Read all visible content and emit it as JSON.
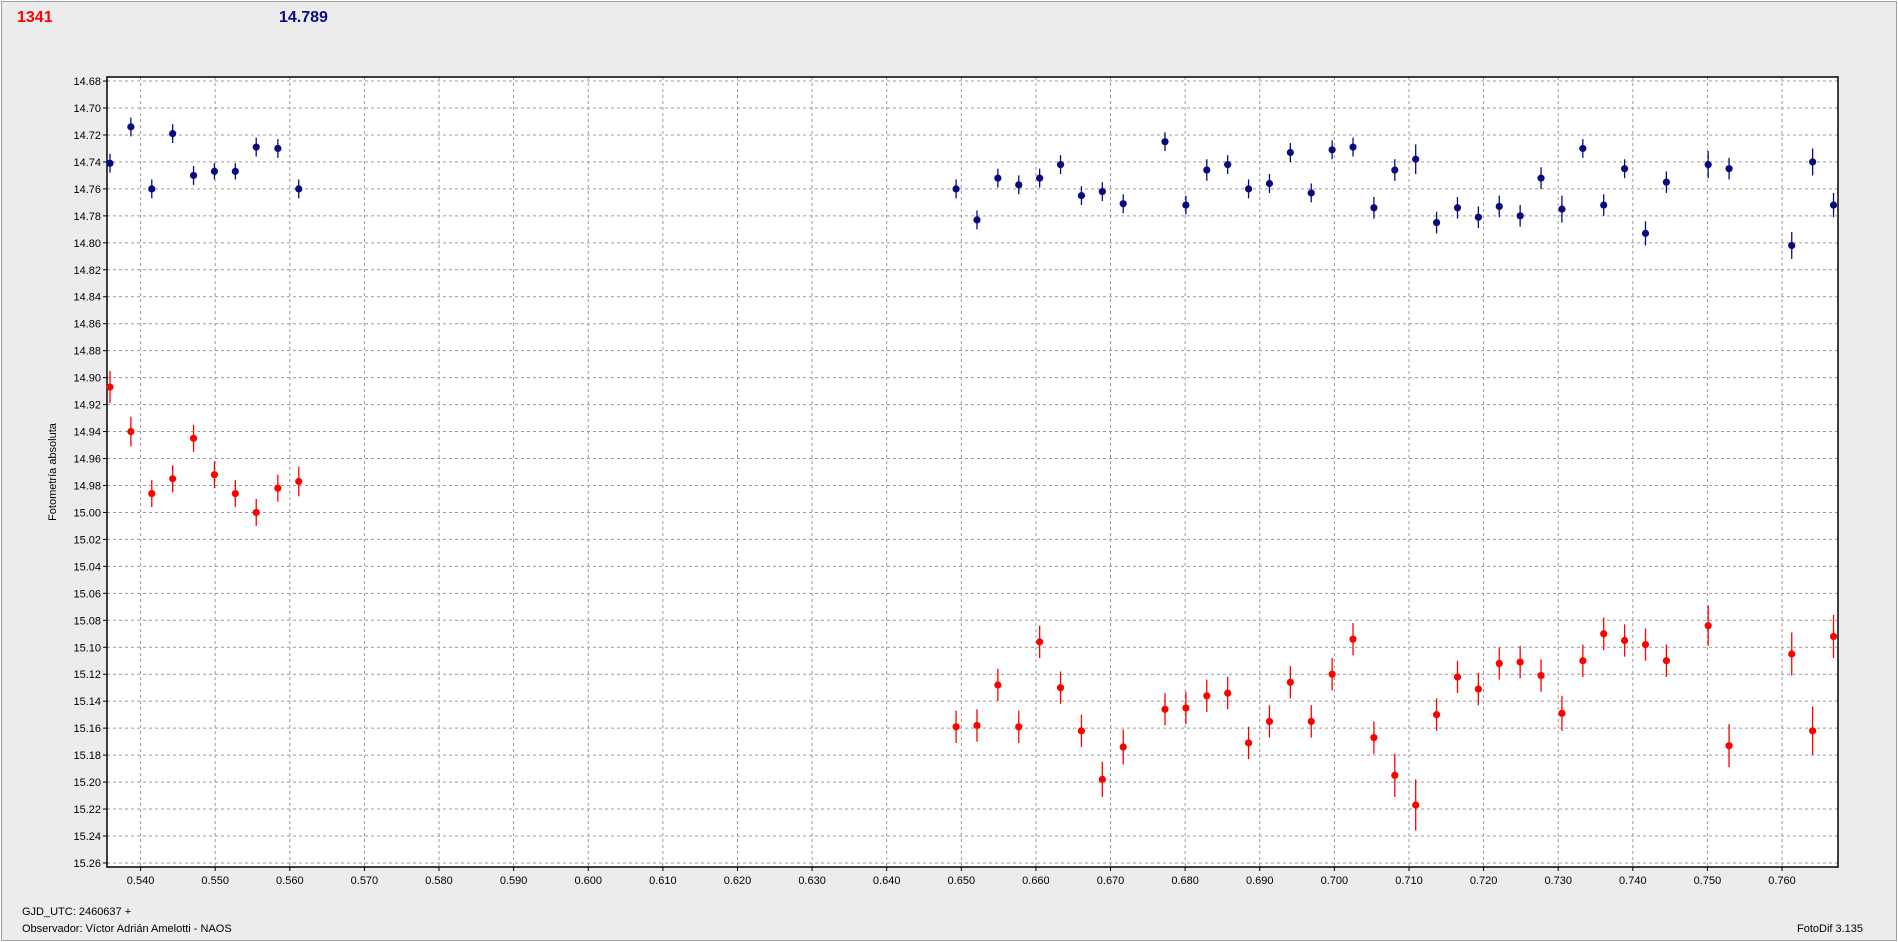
{
  "header": {
    "left_value": "1341",
    "right_value": "14.789"
  },
  "footer": {
    "line1": "GJD_UTC: 2460637 +",
    "line2": "Observador: Víctor Adrián Amelotti - NAOS",
    "version": "FotoDif 3.135"
  },
  "colors": {
    "red_series": "#ff0000",
    "blue_series": "#0a0a80",
    "grid": "#9a9a9a",
    "background": "#ececec",
    "plot_bg": "#ffffff"
  },
  "chart_data": {
    "type": "scatter",
    "ylabel": "Fotometría absoluta",
    "xlabel": "",
    "xlim": [
      0.5355,
      0.7675
    ],
    "ylim": [
      14.677,
      15.263
    ],
    "y_inverted": true,
    "grid": true,
    "x_ticks": [
      "0.540",
      "0.550",
      "0.560",
      "0.570",
      "0.580",
      "0.590",
      "0.600",
      "0.610",
      "0.620",
      "0.630",
      "0.640",
      "0.650",
      "0.660",
      "0.670",
      "0.680",
      "0.690",
      "0.700",
      "0.710",
      "0.720",
      "0.730",
      "0.740",
      "0.750",
      "0.760"
    ],
    "y_ticks": [
      "14.68",
      "14.70",
      "14.72",
      "14.74",
      "14.76",
      "14.78",
      "14.80",
      "14.82",
      "14.84",
      "14.86",
      "14.88",
      "14.90",
      "14.92",
      "14.94",
      "14.96",
      "14.98",
      "15.00",
      "15.02",
      "15.04",
      "15.06",
      "15.08",
      "15.10",
      "15.12",
      "15.14",
      "15.16",
      "15.18",
      "15.20",
      "15.22",
      "15.24",
      "15.26"
    ],
    "series": [
      {
        "color": "#0a0a80",
        "x": [
          0.5359,
          0.5387,
          0.5415,
          0.5443,
          0.5471,
          0.5499,
          0.5527,
          0.5555,
          0.5584,
          0.5612,
          0.6493,
          0.6521,
          0.6549,
          0.6577,
          0.6605,
          0.6633,
          0.6661,
          0.6689,
          0.6717,
          0.6773,
          0.6801,
          0.6829,
          0.6857,
          0.6885,
          0.6913,
          0.6941,
          0.6969,
          0.6997,
          0.7025,
          0.7053,
          0.7081,
          0.7109,
          0.7137,
          0.7165,
          0.7193,
          0.7221,
          0.7249,
          0.7277,
          0.7305,
          0.7333,
          0.7361,
          0.7389,
          0.7417,
          0.7445,
          0.7501,
          0.7529,
          0.7613,
          0.7641,
          0.7669
        ],
        "y": [
          14.741,
          14.714,
          14.76,
          14.719,
          14.75,
          14.747,
          14.747,
          14.729,
          14.73,
          14.76,
          14.76,
          14.783,
          14.752,
          14.757,
          14.752,
          14.742,
          14.765,
          14.762,
          14.771,
          14.725,
          14.772,
          14.746,
          14.742,
          14.76,
          14.756,
          14.733,
          14.763,
          14.731,
          14.729,
          14.774,
          14.746,
          14.738,
          14.785,
          14.774,
          14.781,
          14.773,
          14.78,
          14.752,
          14.775,
          14.73,
          14.772,
          14.745,
          14.793,
          14.755,
          14.742,
          14.745,
          14.802,
          14.74,
          14.772
        ],
        "err": [
          0.007,
          0.007,
          0.007,
          0.007,
          0.007,
          0.006,
          0.006,
          0.007,
          0.007,
          0.007,
          0.007,
          0.007,
          0.007,
          0.007,
          0.007,
          0.007,
          0.007,
          0.007,
          0.007,
          0.007,
          0.007,
          0.008,
          0.007,
          0.007,
          0.007,
          0.007,
          0.007,
          0.007,
          0.007,
          0.008,
          0.008,
          0.011,
          0.008,
          0.008,
          0.008,
          0.008,
          0.008,
          0.008,
          0.01,
          0.007,
          0.008,
          0.007,
          0.009,
          0.008,
          0.01,
          0.008,
          0.01,
          0.01,
          0.009
        ]
      },
      {
        "color": "#ff0000",
        "x": [
          0.5359,
          0.5387,
          0.5415,
          0.5443,
          0.5471,
          0.5499,
          0.5527,
          0.5555,
          0.5584,
          0.5612,
          0.6493,
          0.6521,
          0.6549,
          0.6577,
          0.6605,
          0.6633,
          0.6661,
          0.6689,
          0.6717,
          0.6773,
          0.6801,
          0.6829,
          0.6857,
          0.6885,
          0.6913,
          0.6941,
          0.6969,
          0.6997,
          0.7025,
          0.7053,
          0.7081,
          0.7109,
          0.7137,
          0.7165,
          0.7193,
          0.7221,
          0.7249,
          0.7277,
          0.7305,
          0.7333,
          0.7361,
          0.7389,
          0.7417,
          0.7445,
          0.7501,
          0.7529,
          0.7613,
          0.7641,
          0.7669
        ],
        "y": [
          14.907,
          14.94,
          14.986,
          14.975,
          14.945,
          14.972,
          14.986,
          15.0,
          14.982,
          14.977,
          15.159,
          15.158,
          15.128,
          15.159,
          15.096,
          15.13,
          15.162,
          15.198,
          15.174,
          15.146,
          15.145,
          15.136,
          15.134,
          15.171,
          15.155,
          15.126,
          15.155,
          15.12,
          15.094,
          15.167,
          15.195,
          15.217,
          15.15,
          15.122,
          15.131,
          15.112,
          15.111,
          15.121,
          15.149,
          15.11,
          15.09,
          15.095,
          15.098,
          15.11,
          15.084,
          15.173,
          15.105,
          15.162,
          15.092
        ],
        "err": [
          0.012,
          0.011,
          0.01,
          0.01,
          0.01,
          0.01,
          0.01,
          0.01,
          0.01,
          0.011,
          0.012,
          0.012,
          0.012,
          0.012,
          0.012,
          0.012,
          0.012,
          0.013,
          0.013,
          0.012,
          0.012,
          0.012,
          0.012,
          0.012,
          0.012,
          0.012,
          0.012,
          0.012,
          0.012,
          0.012,
          0.016,
          0.019,
          0.012,
          0.012,
          0.012,
          0.012,
          0.012,
          0.012,
          0.013,
          0.012,
          0.012,
          0.012,
          0.012,
          0.012,
          0.015,
          0.016,
          0.016,
          0.018,
          0.016
        ]
      }
    ]
  }
}
